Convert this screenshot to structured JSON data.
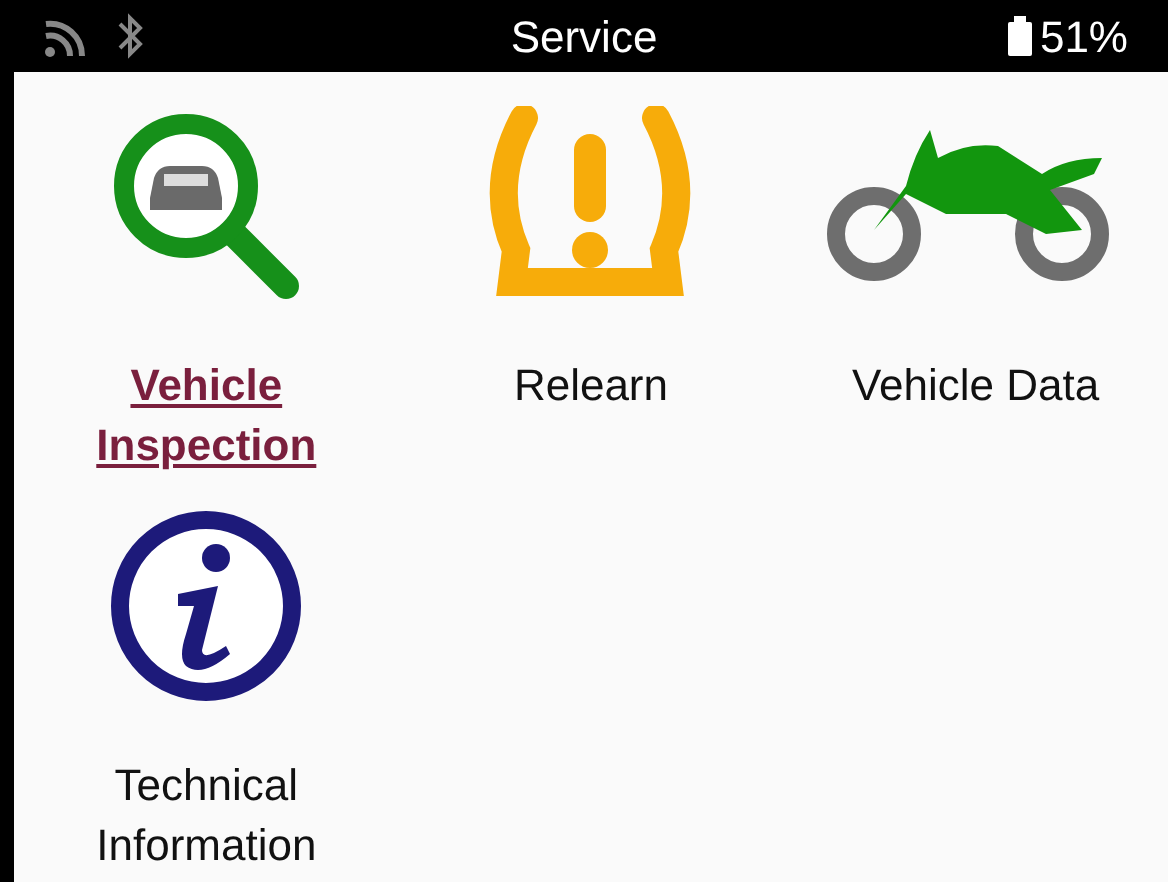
{
  "status_bar": {
    "title": "Service",
    "battery": "51%"
  },
  "menu_items": [
    {
      "label": "Vehicle Inspection",
      "kind": "inspection",
      "selected": true
    },
    {
      "label": "Relearn",
      "kind": "relearn",
      "selected": false
    },
    {
      "label": "Vehicle Data",
      "kind": "vehicle-data",
      "selected": false
    },
    {
      "label": "Technical Information",
      "kind": "info",
      "selected": false
    }
  ]
}
